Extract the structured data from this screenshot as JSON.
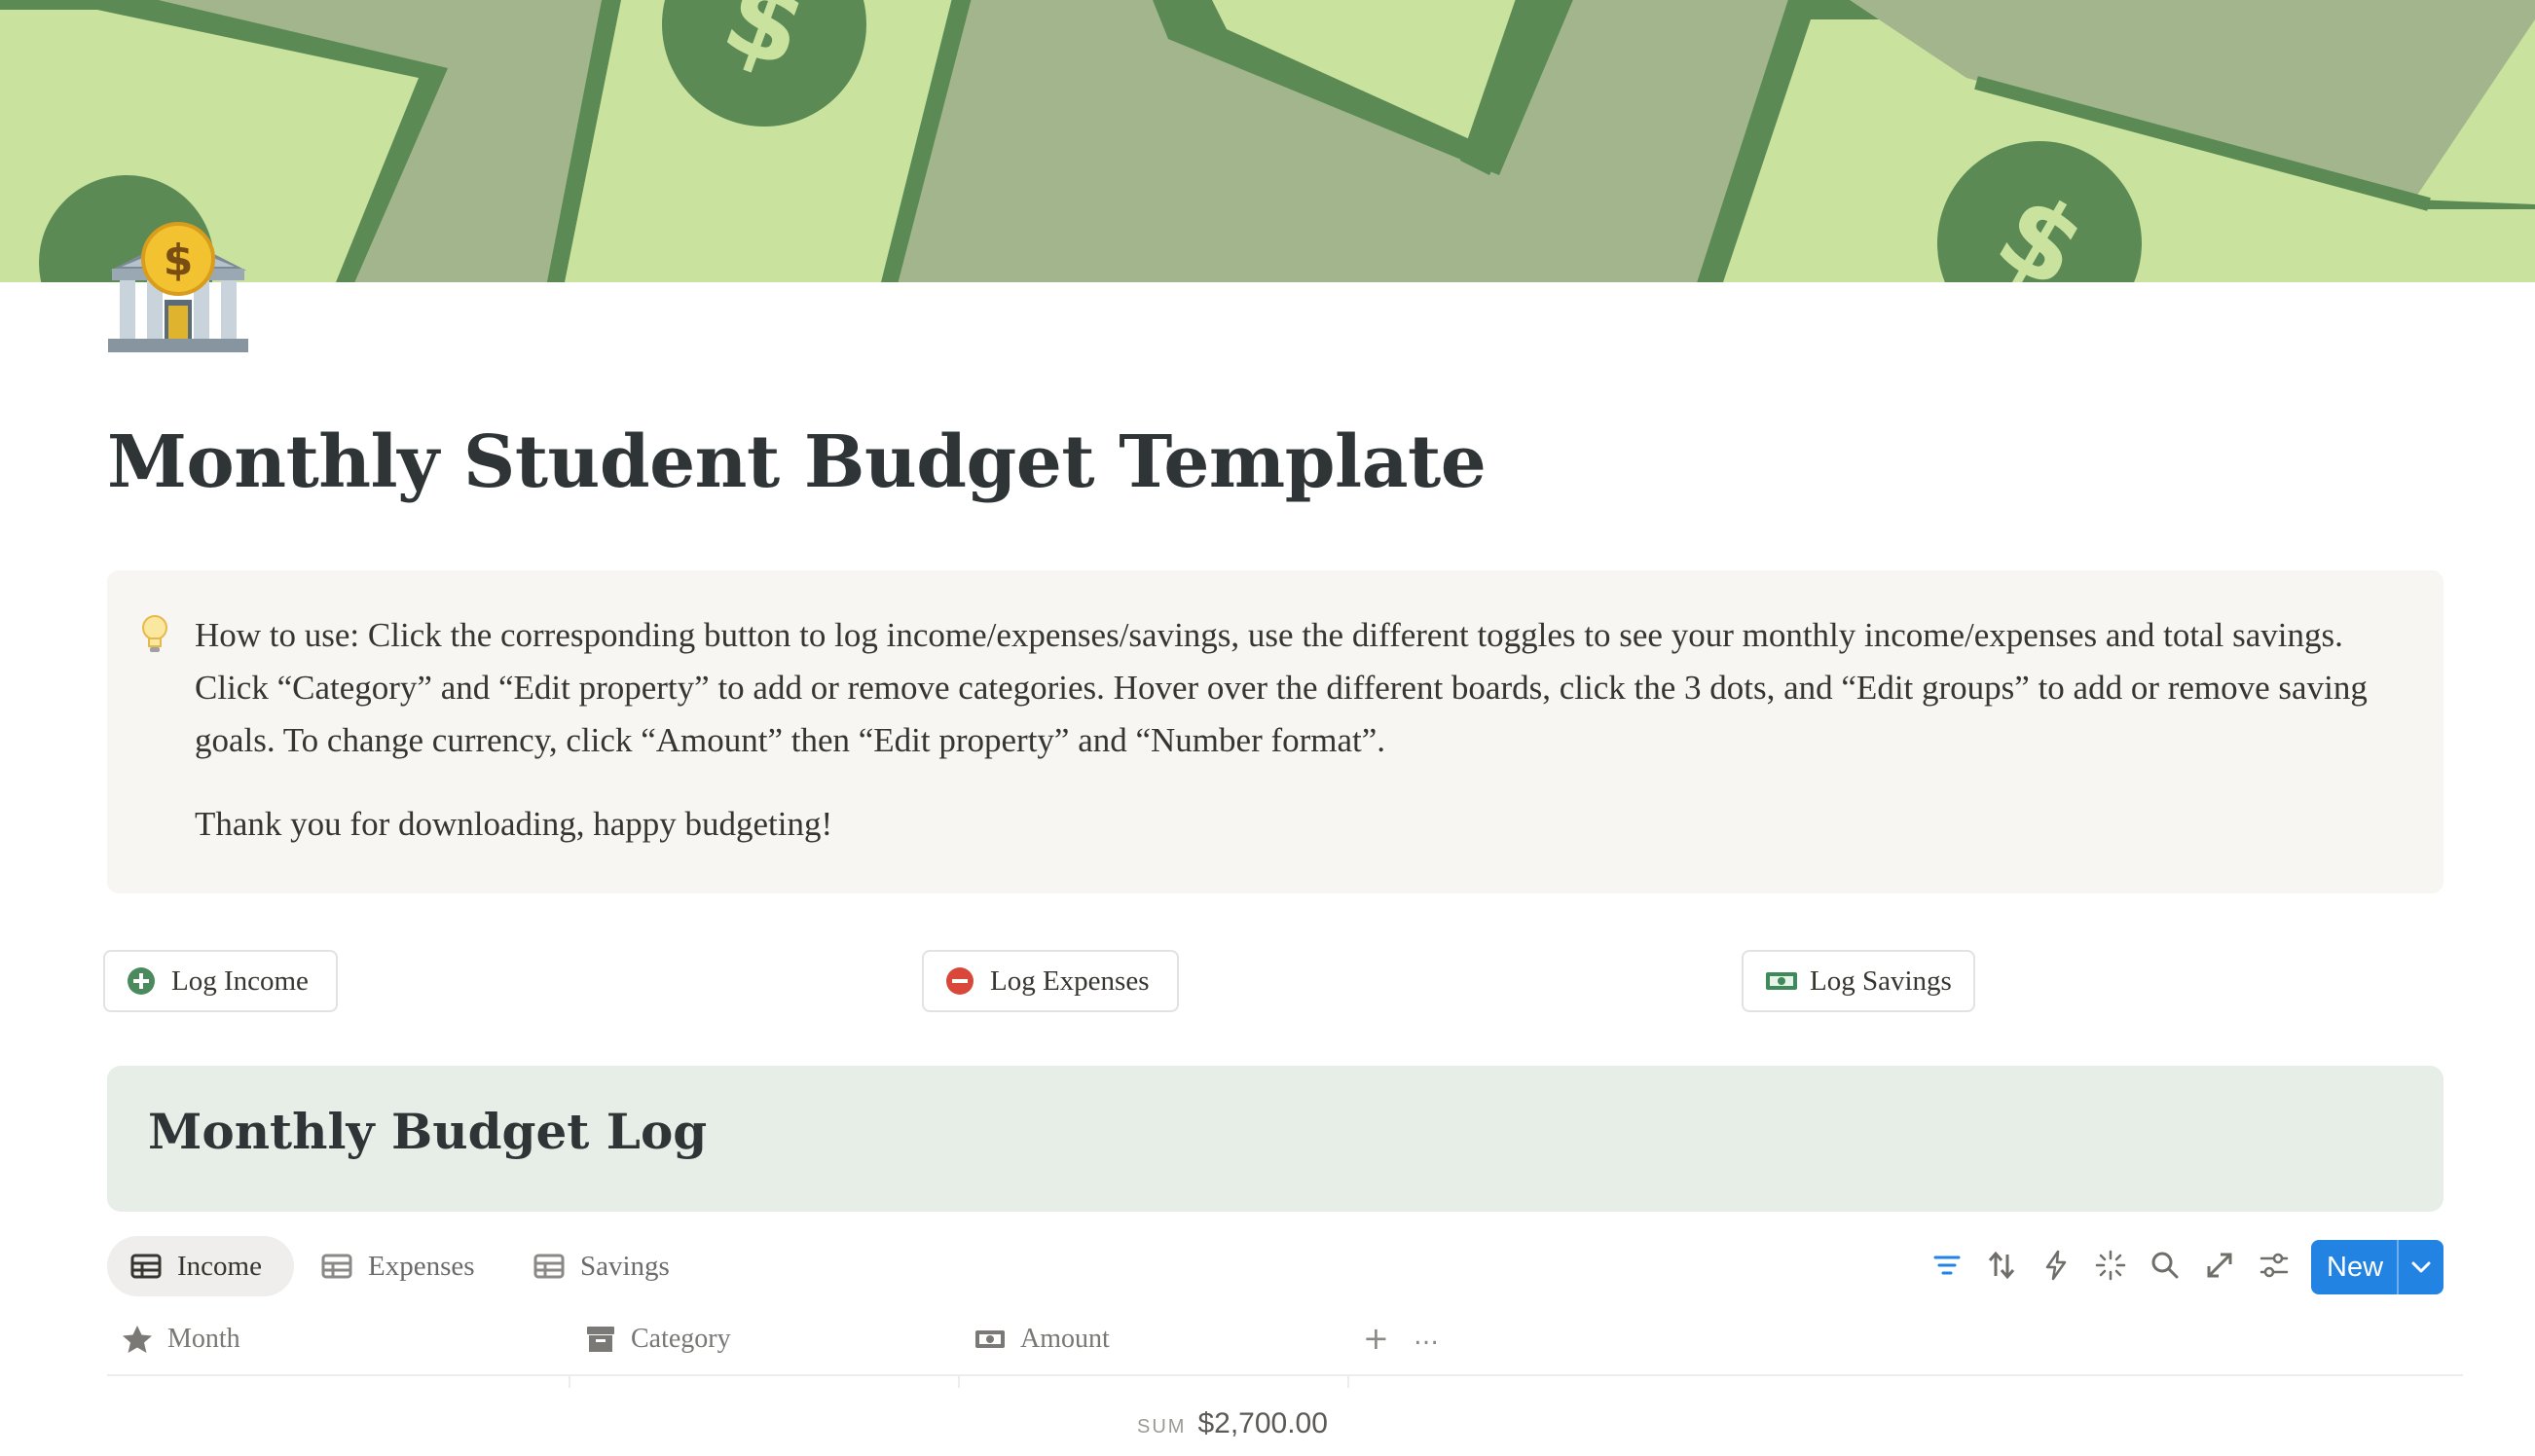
{
  "page": {
    "title": "Monthly Student Budget Template",
    "icon": "bank-icon"
  },
  "callout": {
    "icon": "lightbulb-icon",
    "text": "How to use: Click the corresponding button to log income/expenses/savings, use the different toggles to see your monthly income/expenses and total savings. Click “Category” and “Edit property” to add or remove categories. Hover over the different boards, click the 3 dots, and “Edit groups” to add or remove saving goals. To change currency, click “Amount” then “Edit property” and “Number format”.",
    "text2": "Thank you for downloading, happy budgeting!"
  },
  "buttons": {
    "income": "Log Income",
    "expenses": "Log Expenses",
    "savings": "Log Savings"
  },
  "section": {
    "title": "Monthly Budget Log"
  },
  "views": {
    "tabs": [
      "Income",
      "Expenses",
      "Savings"
    ],
    "active": "Income"
  },
  "toolbar": {
    "icons": [
      "filter-icon",
      "sort-icon",
      "automation-icon",
      "ai-sparkle-icon",
      "search-icon",
      "expand-icon",
      "settings-icon"
    ],
    "new_label": "New"
  },
  "table": {
    "columns": [
      "Month",
      "Category",
      "Amount"
    ],
    "add_column": "+",
    "more": "…",
    "sum_label": "SUM",
    "sum_value": "$2,700.00"
  },
  "colors": {
    "cover_bg": "#a2b58c",
    "bill_light": "#c9e39f",
    "bill_dark": "#5b8a55",
    "accent_blue": "#2383e2",
    "section_bg": "#e6eee7",
    "callout_bg": "#f7f6f3"
  }
}
